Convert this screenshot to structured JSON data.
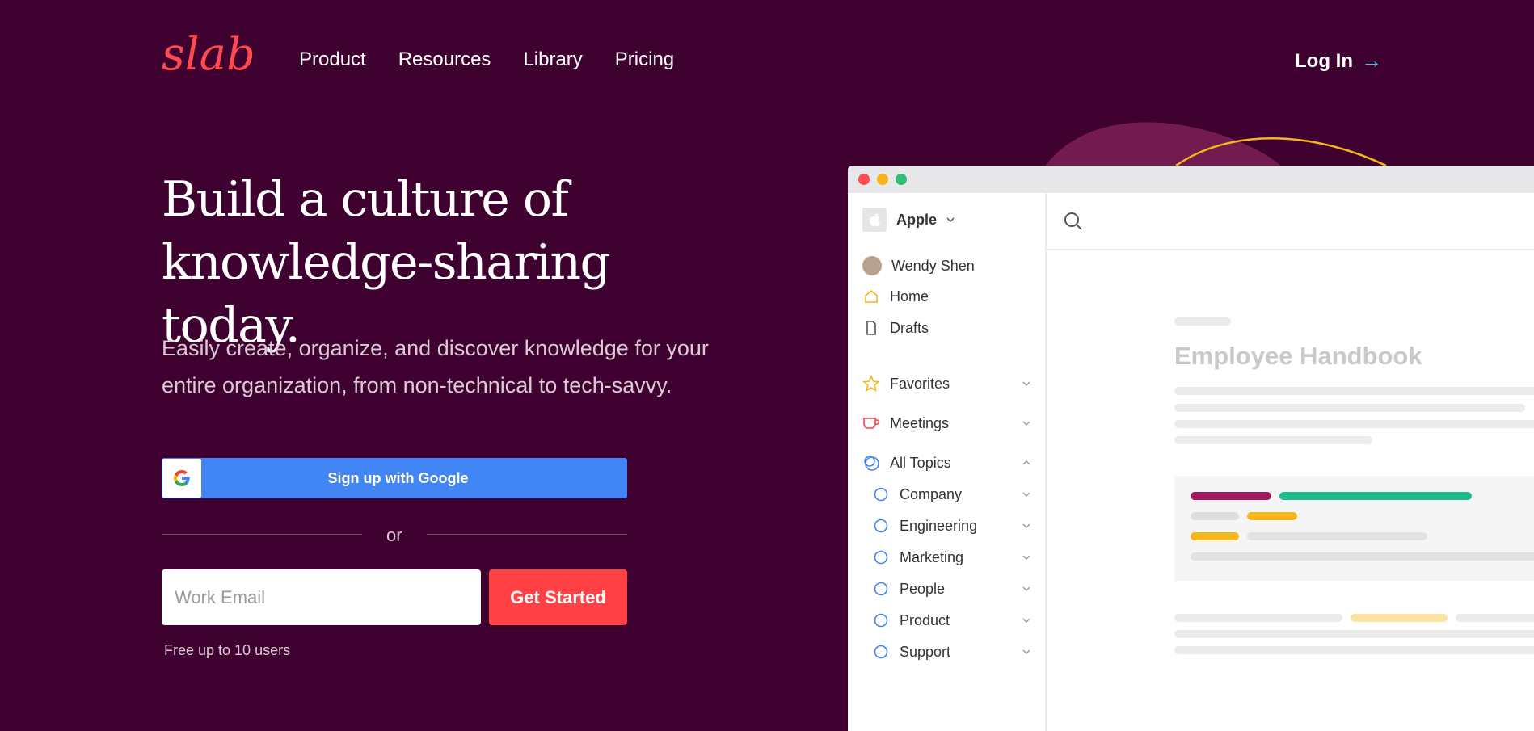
{
  "header": {
    "logo_text": "slab",
    "nav": [
      "Product",
      "Resources",
      "Library",
      "Pricing"
    ],
    "login_label": "Log In",
    "login_arrow": "→"
  },
  "hero": {
    "headline_line1": "Build a culture of",
    "headline_line2": "knowledge-sharing today.",
    "subtitle_line1": "Easily create, organize, and discover knowledge for your",
    "subtitle_line2": "entire organization, from non-technical to tech-savvy.",
    "google_button": "Sign up with Google",
    "or_text": "or",
    "email_placeholder": "Work Email",
    "cta_label": "Get Started",
    "free_note": "Free up to 10 users"
  },
  "app": {
    "workspace": "Apple",
    "user": "Wendy Shen",
    "nav": {
      "home": "Home",
      "drafts": "Drafts"
    },
    "sections": {
      "favorites": "Favorites",
      "meetings": "Meetings",
      "all_topics": "All Topics"
    },
    "topics": [
      "Company",
      "Engineering",
      "Marketing",
      "People",
      "Product",
      "Support"
    ],
    "doc_title": "Employee Handbook"
  },
  "colors": {
    "background": "#3f0230",
    "brand_red": "#ff4045",
    "google_blue": "#4285f4",
    "accent_yellow": "#f7b51c",
    "accent_teal": "#3ec6e6"
  }
}
